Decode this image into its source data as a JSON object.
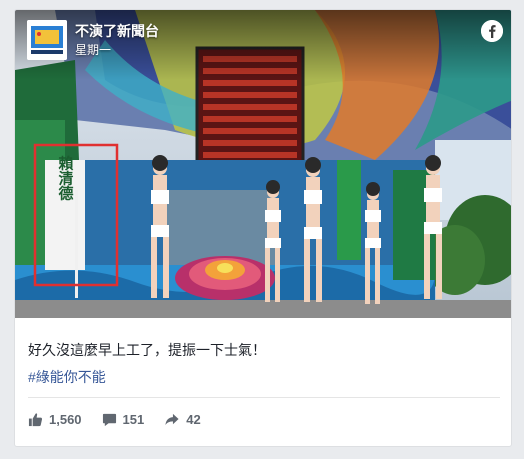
{
  "post": {
    "page_name": "不演了新聞台",
    "time": "星期一",
    "avatar_text": "不演了新聞台",
    "caption": "好久沒這麼早上工了，提振一下士氣！",
    "hashtag": "#綠能你不能",
    "banner_text": "賴清德"
  },
  "stats": {
    "likes": "1,560",
    "comments": "151",
    "shares": "42"
  },
  "icons": {
    "facebook": "facebook-icon",
    "like": "thumbs-up-icon",
    "comment": "comment-icon",
    "share": "share-arrow-icon"
  },
  "colors": {
    "link": "#385898",
    "text": "#1d2129",
    "muted": "#606770",
    "highlight_box": "#e03030"
  }
}
